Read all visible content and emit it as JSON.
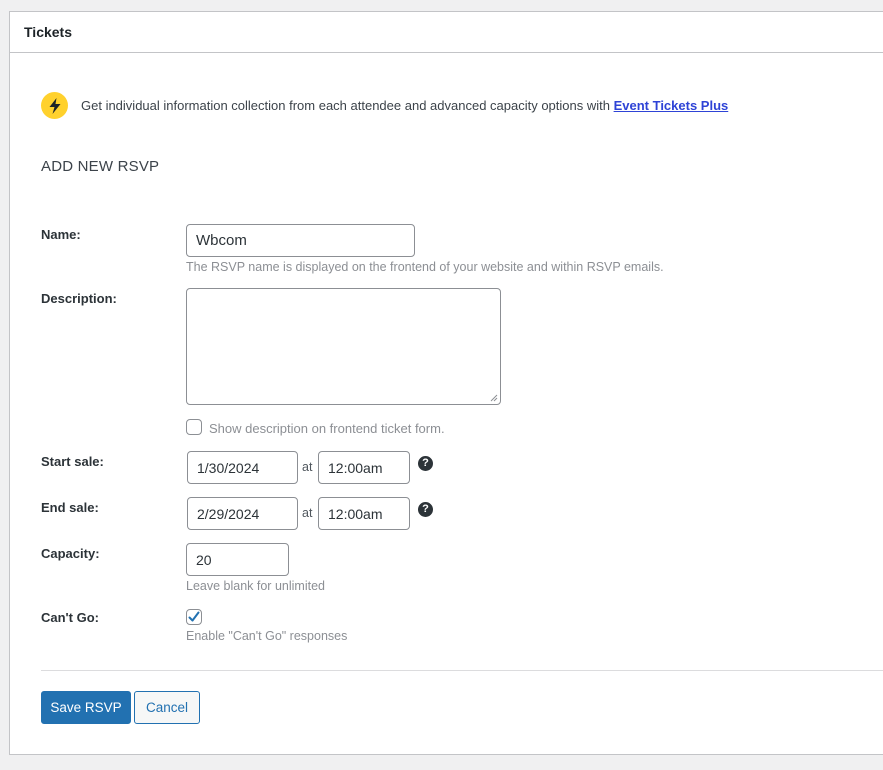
{
  "panel": {
    "title": "Tickets"
  },
  "notice": {
    "icon": "lightning-bolt-icon",
    "icon_color": "#ffd12d",
    "text": "Get individual information collection from each attendee and advanced capacity options with ",
    "link_text": "Event Tickets Plus"
  },
  "form": {
    "section_title": "ADD NEW RSVP",
    "name": {
      "label": "Name:",
      "value": "Wbcom",
      "help": "The RSVP name is displayed on the frontend of your website and within RSVP emails."
    },
    "description": {
      "label": "Description:",
      "value": "",
      "checkbox_label": "Show description on frontend ticket form.",
      "checkbox_checked": false
    },
    "start_sale": {
      "label": "Start sale:",
      "date": "1/30/2024",
      "at": "at",
      "time": "12:00am",
      "help_icon": "question-circle-icon"
    },
    "end_sale": {
      "label": "End sale:",
      "date": "2/29/2024",
      "at": "at",
      "time": "12:00am",
      "help_icon": "question-circle-icon"
    },
    "capacity": {
      "label": "Capacity:",
      "value": "20",
      "help": "Leave blank for unlimited"
    },
    "cant_go": {
      "label": "Can't Go:",
      "checked": true,
      "help": "Enable \"Can't Go\" responses"
    }
  },
  "actions": {
    "save_label": "Save RSVP",
    "cancel_label": "Cancel"
  },
  "colors": {
    "primary": "#2271b1",
    "link": "#2e43d6",
    "muted_text": "#8c8f94"
  }
}
